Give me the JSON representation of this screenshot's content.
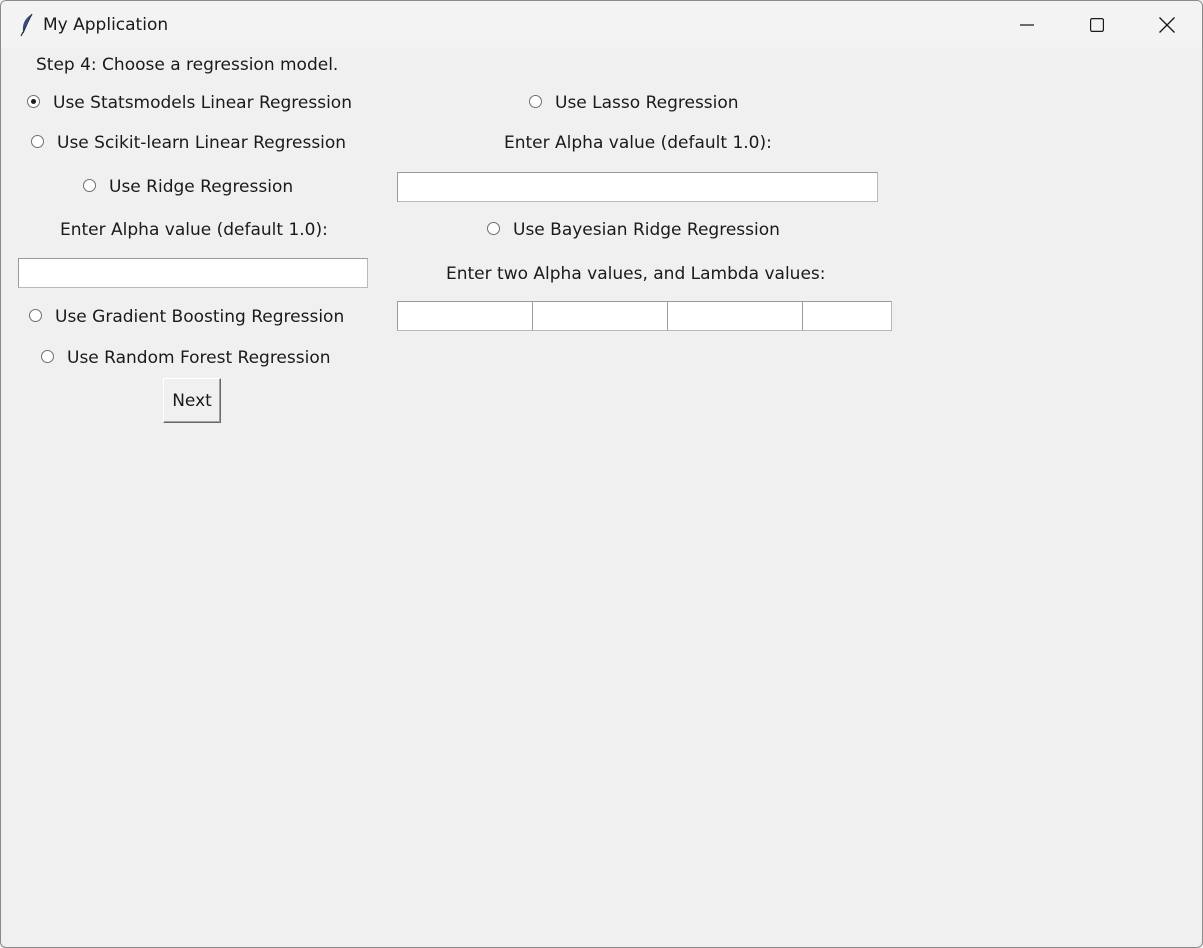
{
  "window": {
    "title": "My Application",
    "icon": "feather-icon"
  },
  "step_label": "Step 4: Choose a regression model.",
  "left": {
    "statsmodels": {
      "label": "Use Statsmodels Linear Regression",
      "selected": true
    },
    "sklearn": {
      "label": "Use Scikit-learn Linear Regression",
      "selected": false
    },
    "ridge": {
      "label": "Use Ridge Regression",
      "selected": false
    },
    "ridge_alpha_label": "Enter Alpha value (default 1.0):",
    "ridge_alpha_value": "",
    "gradient_boosting": {
      "label": "Use Gradient Boosting Regression",
      "selected": false
    },
    "random_forest": {
      "label": "Use Random Forest Regression",
      "selected": false
    },
    "next_label": "Next"
  },
  "right": {
    "lasso": {
      "label": "Use Lasso Regression",
      "selected": false
    },
    "lasso_alpha_label": "Enter Alpha value (default 1.0):",
    "lasso_alpha_value": "",
    "bayesian_ridge": {
      "label": "Use Bayesian Ridge Regression",
      "selected": false
    },
    "bayesian_params_label": "Enter two Alpha values, and Lambda values:",
    "bayesian_values": [
      "",
      "",
      "",
      ""
    ]
  }
}
